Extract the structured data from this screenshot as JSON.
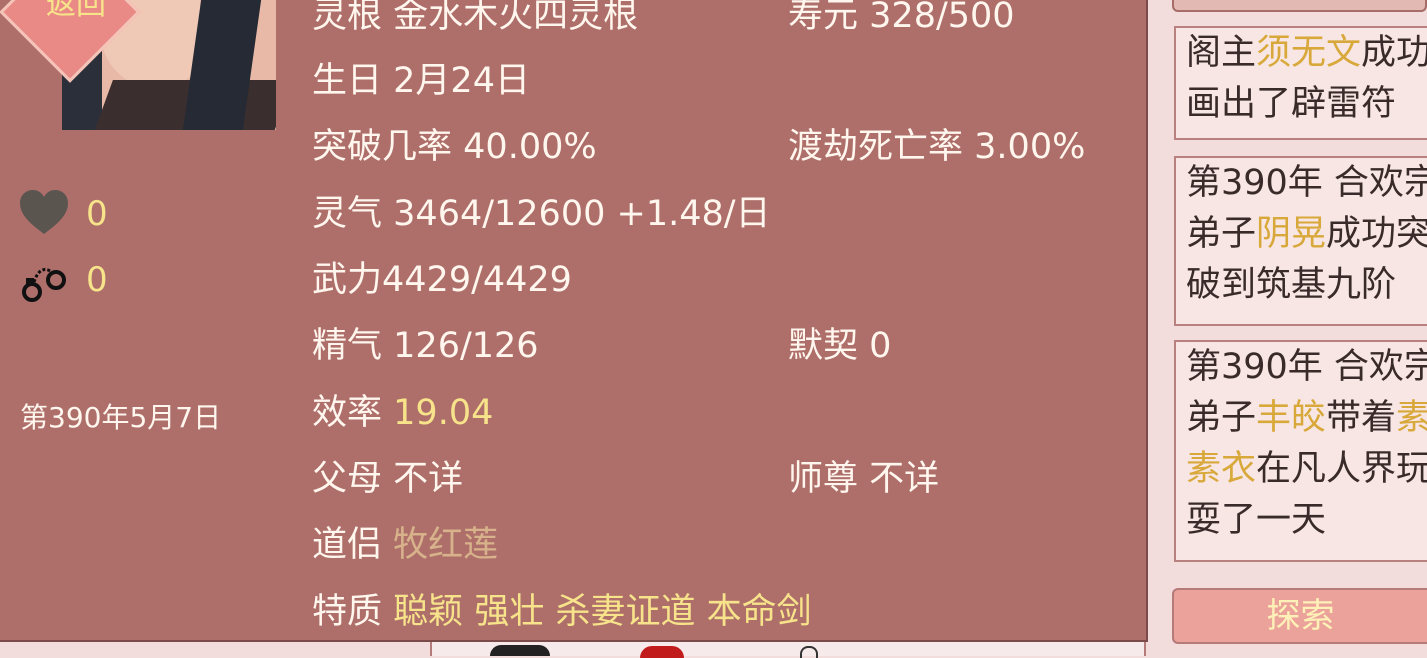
{
  "back_label": "返回",
  "counts": {
    "heart": "0",
    "cuff": "0"
  },
  "date": "第390年5月7日",
  "stats": {
    "linggen": {
      "label": "灵根",
      "value": "金水木火四灵根"
    },
    "shouyuan": {
      "label": "寿元",
      "value": "328/500"
    },
    "birthday": {
      "label": "生日",
      "value": "2月24日"
    },
    "breakthrough": {
      "label": "突破几率",
      "value": "40.00%"
    },
    "dujie": {
      "label": "渡劫死亡率",
      "value": "3.00%"
    },
    "lingqi": {
      "label": "灵气",
      "value": "3464/12600 +1.48/日"
    },
    "wuli": {
      "label": "武力",
      "value": "4429/4429"
    },
    "jingqi": {
      "label": "精气",
      "value": "126/126"
    },
    "moqi": {
      "label": "默契",
      "value": "0"
    },
    "efficiency": {
      "label": "效率",
      "value": "19.04"
    },
    "parents": {
      "label": "父母",
      "value": "不详"
    },
    "master": {
      "label": "师尊",
      "value": "不详"
    },
    "daolv": {
      "label": "道侣",
      "value": "牧红莲"
    },
    "traits": {
      "label": "特质",
      "values": [
        "聪颖",
        "强壮",
        "杀妻证道",
        "本命剑"
      ]
    }
  },
  "events": [
    {
      "l1a": "阁主",
      "l1b": "须无文",
      "l1c": "成功",
      "l2": "画出了辟雷符"
    },
    {
      "l1": "第390年 合欢宗",
      "l2a": "弟子",
      "l2b": "阴晃",
      "l2c": "成功突",
      "l3": "破到筑基九阶"
    },
    {
      "l1": "第390年 合欢宗",
      "l2a": "弟子",
      "l2b": "丰皎",
      "l2c": "带着",
      "l2d": "素",
      "l3a": "素衣",
      "l3b": "在凡人界玩",
      "l4": "耍了一天"
    }
  ],
  "explore_label": "探索",
  "colors": {
    "panel": "#ae6f6b",
    "highlight": "#f7e38a",
    "text": "#fff6ee"
  }
}
